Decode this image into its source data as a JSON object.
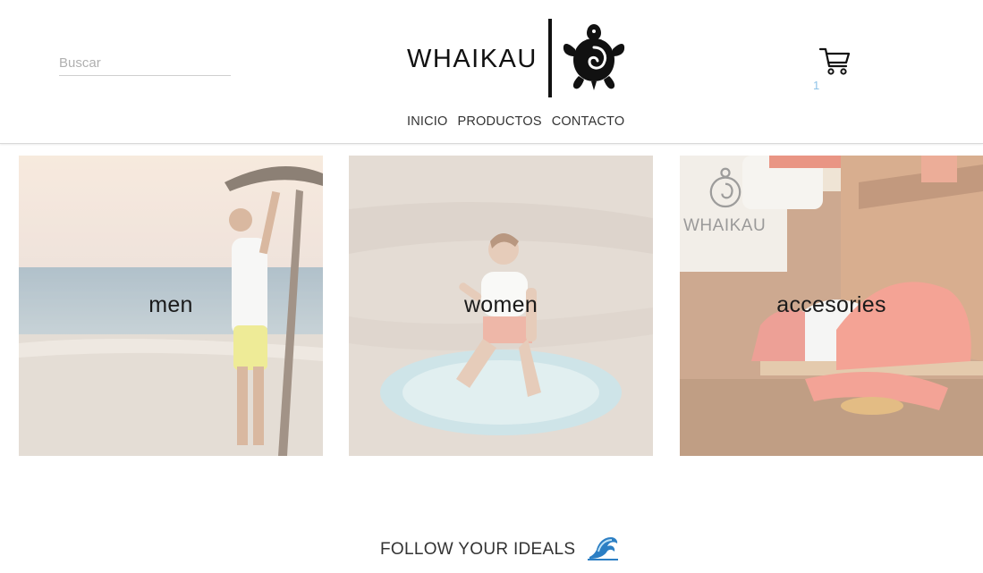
{
  "header": {
    "search": {
      "placeholder": "Buscar",
      "value": ""
    },
    "brand": {
      "name": "WHAIKAU",
      "logo_icon": "turtle-icon"
    },
    "cart": {
      "icon": "shopping-cart-icon",
      "count": "1",
      "count_color": "#8fc3e8"
    },
    "nav": [
      {
        "label": "INICIO"
      },
      {
        "label": "PRODUCTOS"
      },
      {
        "label": "CONTACTO"
      }
    ]
  },
  "categories": [
    {
      "label": "men"
    },
    {
      "label": "women"
    },
    {
      "label": "accesories",
      "sign_text": "WHAIKAU"
    }
  ],
  "footer": {
    "tagline": "FOLLOW YOUR IDEALS",
    "icon": "water-wave-icon"
  },
  "colors": {
    "accent": "#8fc3e8",
    "text": "#222222",
    "divider": "#d9d9d9"
  }
}
